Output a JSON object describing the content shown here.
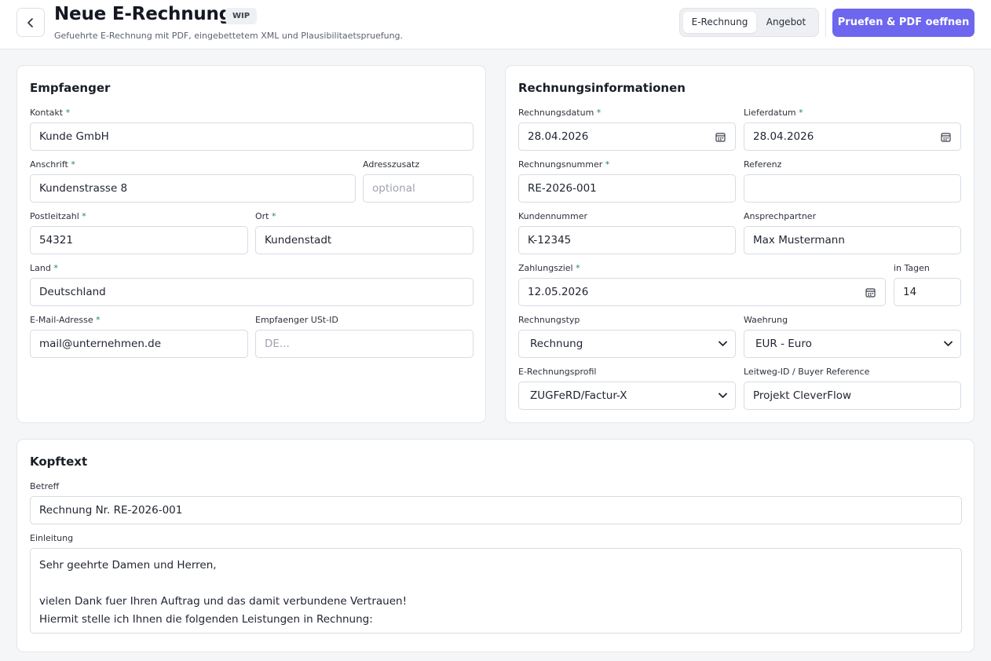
{
  "header": {
    "title": "Neue E-Rechnung",
    "badge": "WIP",
    "subtitle": "Gefuehrte E-Rechnung mit PDF, eingebettetem XML und Plausibilitaetspruefung.",
    "tabs": [
      "E-Rechnung",
      "Angebot"
    ],
    "active_tab": "E-Rechnung",
    "primary_button": "Pruefen & PDF oeffnen",
    "accent_color": "#6d66ee"
  },
  "recipient": {
    "title": "Empfaenger",
    "contact": {
      "label": "Kontakt",
      "required": "*",
      "value": "Kunde GmbH"
    },
    "address": {
      "label": "Anschrift",
      "required": "*",
      "value": "Kundenstrasse 8"
    },
    "address_extra": {
      "label": "Adresszusatz",
      "placeholder": "optional"
    },
    "postal_code": {
      "label": "Postleitzahl",
      "required": "*",
      "value": "54321"
    },
    "city": {
      "label": "Ort",
      "required": "*",
      "value": "Kundenstadt"
    },
    "country": {
      "label": "Land",
      "required": "*",
      "value": "Deutschland"
    },
    "email": {
      "label": "E-Mail-Adresse",
      "required": "*",
      "value": "mail@unternehmen.de"
    },
    "vat_id": {
      "label": "Empfaenger USt-ID",
      "placeholder": "DE..."
    }
  },
  "invoice": {
    "title": "Rechnungsinformationen",
    "invoice_date": {
      "label": "Rechnungsdatum",
      "required": "*",
      "value": "28.04.2026"
    },
    "delivery_date": {
      "label": "Lieferdatum",
      "required": "*",
      "value": "28.04.2026"
    },
    "invoice_number": {
      "label": "Rechnungsnummer",
      "required": "*",
      "value": "RE-2026-001"
    },
    "reference": {
      "label": "Referenz",
      "value": ""
    },
    "customer_number": {
      "label": "Kundennummer",
      "value": "K-12345"
    },
    "contact_person": {
      "label": "Ansprechpartner",
      "value": "Max Mustermann"
    },
    "payment_due": {
      "label": "Zahlungsziel",
      "required": "*",
      "value": "12.05.2026"
    },
    "days": {
      "label": "in Tagen",
      "value": "14"
    },
    "invoice_type": {
      "label": "Rechnungstyp",
      "value": "Rechnung"
    },
    "currency": {
      "label": "Waehrung",
      "value": "EUR - Euro"
    },
    "profile": {
      "label": "E-Rechnungsprofil",
      "value": "ZUGFeRD/Factur-X"
    },
    "buyer_reference": {
      "label": "Leitweg-ID / Buyer Reference",
      "value": "Projekt CleverFlow"
    }
  },
  "header_text": {
    "title": "Kopftext",
    "subject": {
      "label": "Betreff",
      "value": "Rechnung Nr. RE-2026-001"
    },
    "intro": {
      "label": "Einleitung",
      "value": "Sehr geehrte Damen und Herren,\n\nvielen Dank fuer Ihren Auftrag und das damit verbundene Vertrauen!\nHiermit stelle ich Ihnen die folgenden Leistungen in Rechnung:"
    }
  }
}
